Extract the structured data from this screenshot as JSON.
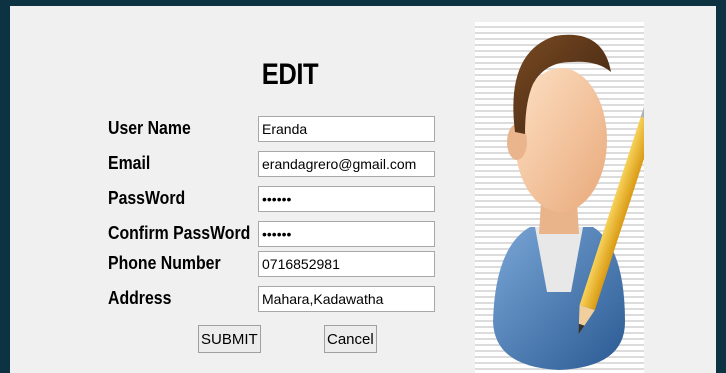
{
  "form": {
    "title": "EDIT",
    "fields": [
      {
        "label": "User Name",
        "value": "Eranda"
      },
      {
        "label": "Email",
        "value": "erandagrero@gmail.com"
      },
      {
        "label": "PassWord",
        "value": "••••••"
      },
      {
        "label": "Confirm PassWord",
        "value": "••••••"
      },
      {
        "label": "Phone Number",
        "value": "0716852981"
      },
      {
        "label": "Address",
        "value": "Mahara,Kadawatha"
      }
    ],
    "submit_label": "SUBMIT",
    "cancel_label": "Cancel"
  },
  "image": {
    "icon": "user-edit-icon"
  }
}
